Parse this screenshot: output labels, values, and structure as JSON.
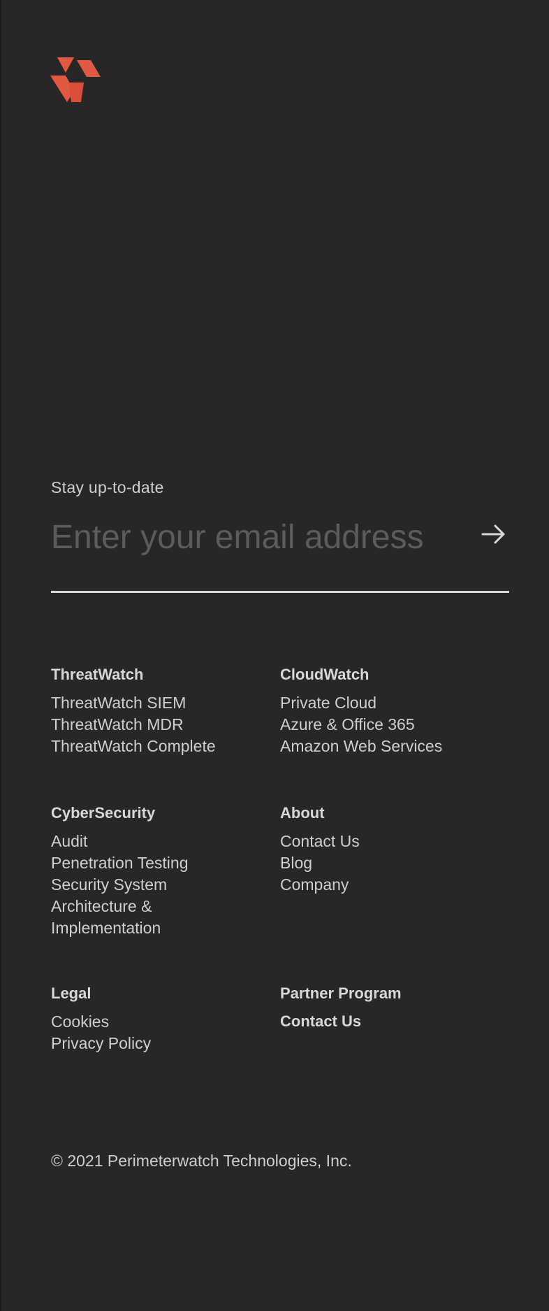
{
  "brand": {
    "logo_icon": "perimeterwatch-logo",
    "accent_color": "#e05a43"
  },
  "newsletter": {
    "label": "Stay up-to-date",
    "email_placeholder": "Enter your email address",
    "submit_icon": "arrow-right-icon"
  },
  "footer": {
    "threatwatch": {
      "title": "ThreatWatch",
      "links": [
        "ThreatWatch SIEM",
        "ThreatWatch MDR",
        "ThreatWatch Complete"
      ]
    },
    "cloudwatch": {
      "title": "CloudWatch",
      "links": [
        "Private Cloud",
        "Azure & Office 365",
        "Amazon Web Services"
      ]
    },
    "cybersecurity": {
      "title": "CyberSecurity",
      "links": [
        "Audit",
        "Penetration Testing",
        "Security System",
        "Architecture &",
        "Implementation"
      ]
    },
    "about": {
      "title": "About",
      "links": [
        "Contact Us",
        "Blog",
        "Company"
      ]
    },
    "legal": {
      "title": "Legal",
      "links": [
        "Cookies",
        "Privacy Policy"
      ]
    },
    "partner": {
      "title": "Partner Program",
      "contact": "Contact Us"
    }
  },
  "copyright": "© 2021 Perimeterwatch Technologies, Inc."
}
